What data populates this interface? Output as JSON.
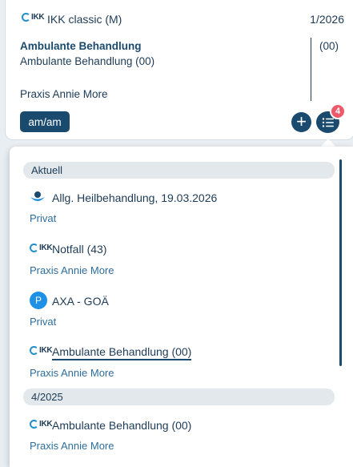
{
  "card": {
    "insurance_name": "IKK classic (M)",
    "quarter": "1/2026",
    "case_title": "Ambulante Behandlung",
    "case_subtitle": "Ambulante Behandlung (00)",
    "case_code": "(00)",
    "practice": "Praxis Annie More",
    "chip_label": "am/am",
    "add_label": "+",
    "badge_count": "4",
    "logo_text": "IKK"
  },
  "dropdown": {
    "sections": [
      {
        "header": "Aktuell",
        "items": [
          {
            "title": "Allg. Heilbehandlung, 19.03.2026",
            "sub": "Privat",
            "icon": "bg-insurance-icon"
          },
          {
            "title": "Notfall (43)",
            "sub": "Praxis Annie More",
            "icon": "ikk-logo-icon"
          },
          {
            "title": "AXA - GOÄ",
            "sub": "Privat",
            "icon": "private-p-icon",
            "icon_text": "P"
          },
          {
            "title": "Ambulante Behandlung (00)",
            "sub": "Praxis Annie More",
            "icon": "ikk-logo-icon"
          }
        ]
      },
      {
        "header": "4/2025",
        "items": [
          {
            "title": "Ambulante Behandlung (00)",
            "sub": "Praxis Annie More",
            "icon": "ikk-logo-icon"
          }
        ]
      }
    ]
  },
  "colors": {
    "primary": "#1a4a6e",
    "badge": "#ee5a6a",
    "accent_blue": "#1e90e6",
    "ikk_blue": "#1f8fcf"
  }
}
